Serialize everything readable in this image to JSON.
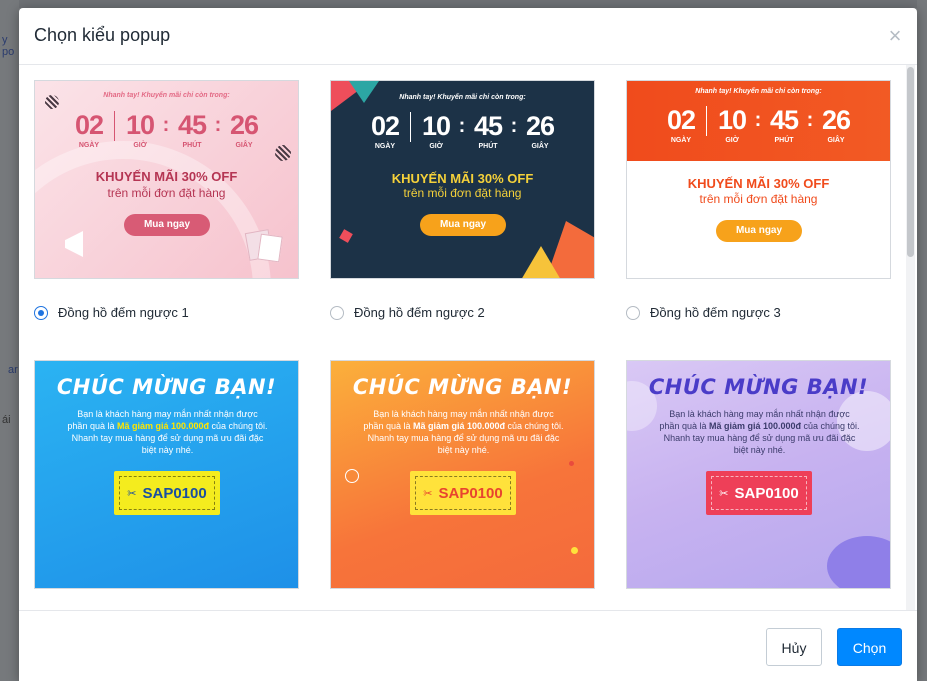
{
  "modal": {
    "title": "Chọn kiểu popup",
    "close_symbol": "×",
    "cancel_label": "Hủy",
    "confirm_label": "Chọn"
  },
  "background": {
    "fragments": [
      "y po",
      "ar",
      "ái"
    ]
  },
  "countdown": {
    "headline": "Nhanh tay! Khuyến mãi chỉ còn trong:",
    "days": "02",
    "hours": "10",
    "minutes": "45",
    "seconds": "26",
    "label_days": "NGÀY",
    "label_hours": "GIỜ",
    "label_minutes": "PHÚT",
    "label_seconds": "GIÂY",
    "promo": "KHUYẾN MÃI 30% OFF",
    "subtext": "trên mỗi đơn đặt hàng",
    "button": "Mua ngay"
  },
  "coupon": {
    "title": "CHÚC MỪNG BẠN!",
    "line1": "Bạn là khách hàng may mắn nhất nhận được",
    "line2_pre": "phần quà là ",
    "line2_bold": "Mã giảm giá 100.000đ",
    "line2_post": " của chúng tôi.",
    "line3": "Nhanh tay mua hàng để sử dụng mã ưu đãi đặc",
    "line4": "biệt này nhé.",
    "code": "SAP0100"
  },
  "options": [
    {
      "label": "Đồng hồ đếm ngược 1",
      "selected": true
    },
    {
      "label": "Đồng hồ đếm ngược 2",
      "selected": false
    },
    {
      "label": "Đồng hồ đếm ngược 3",
      "selected": false
    }
  ],
  "colors": {
    "primary": "#0088ff",
    "radio_selected": "#1f74e0",
    "countdown1_bg": "#f8cfd8",
    "countdown2_bg": "#1c3247",
    "countdown3_header": "#f04b1c",
    "coupon1_bg": "#1ea5ec",
    "coupon2_bg": "#f98b3a",
    "coupon3_bg": "#c7b2f0"
  }
}
